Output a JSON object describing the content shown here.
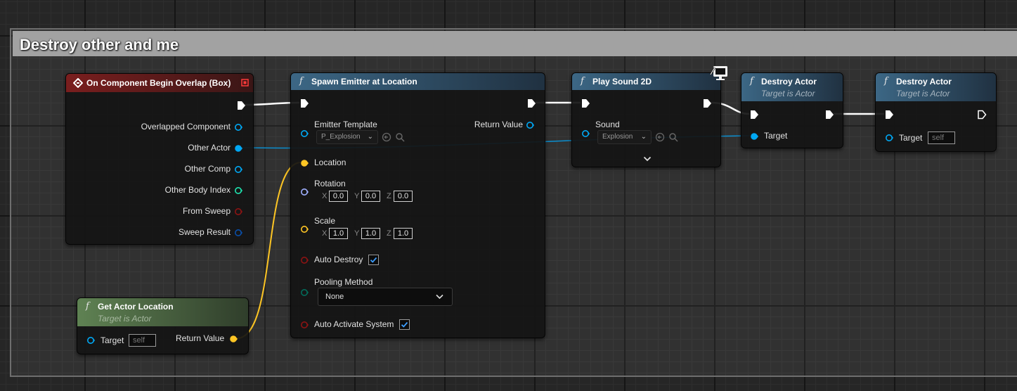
{
  "comment": {
    "title": "Destroy other and me"
  },
  "colors": {
    "event_header": "#7a1e1e",
    "function_header": "#3c6785",
    "pure_header": "#5f8253",
    "exec_wire": "#ffffff",
    "object_wire": "#00a8f4",
    "vector_wire": "#fdc524"
  },
  "event_node": {
    "title": "On Component Begin Overlap (Box)",
    "outputs": [
      "Overlapped Component",
      "Other Actor",
      "Other Comp",
      "Other Body Index",
      "From Sweep",
      "Sweep Result"
    ]
  },
  "spawn_emitter": {
    "fn_glyph": "f",
    "title": "Spawn Emitter at Location",
    "emitter_template_label": "Emitter Template",
    "emitter_template_value": "P_Explosion",
    "return_value_label": "Return Value",
    "location_label": "Location",
    "rotation_label": "Rotation",
    "rotation": {
      "x": "0.0",
      "y": "0.0",
      "z": "0.0"
    },
    "scale_label": "Scale",
    "scale": {
      "x": "1.0",
      "y": "1.0",
      "z": "1.0"
    },
    "axis_x": "X",
    "axis_y": "Y",
    "axis_z": "Z",
    "auto_destroy_label": "Auto Destroy",
    "auto_destroy": true,
    "pooling_method_label": "Pooling Method",
    "pooling_method_value": "None",
    "auto_activate_label": "Auto Activate System",
    "auto_activate": true
  },
  "play_sound": {
    "fn_glyph": "f",
    "title": "Play Sound 2D",
    "sound_label": "Sound",
    "sound_value": "Explosion"
  },
  "destroy_actor_1": {
    "fn_glyph": "f",
    "title": "Destroy Actor",
    "subtitle": "Target is Actor",
    "target_label": "Target"
  },
  "destroy_actor_2": {
    "fn_glyph": "f",
    "title": "Destroy Actor",
    "subtitle": "Target is Actor",
    "target_label": "Target",
    "target_value": "self"
  },
  "get_actor_location": {
    "fn_glyph": "f",
    "title": "Get Actor Location",
    "subtitle": "Target is Actor",
    "target_label": "Target",
    "target_value": "self",
    "return_value_label": "Return Value"
  }
}
